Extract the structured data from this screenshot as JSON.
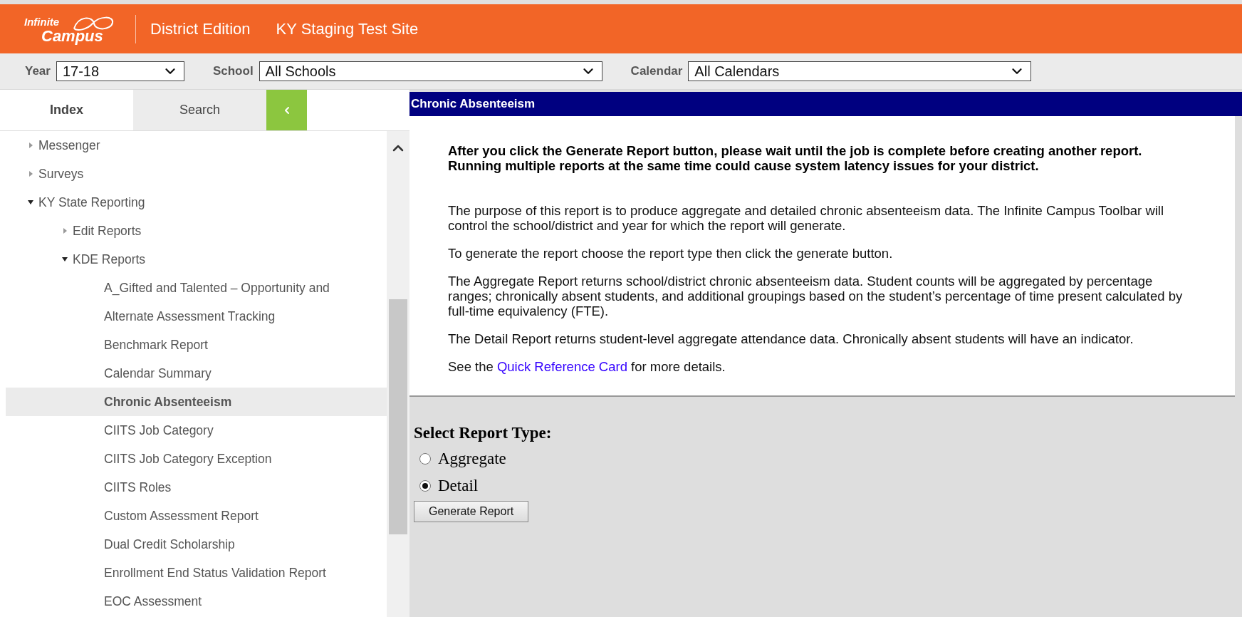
{
  "header": {
    "logo": {
      "top": "Infinite",
      "bottom": "Campus"
    },
    "edition": "District Edition",
    "site": "KY Staging Test Site"
  },
  "toolbar": [
    {
      "label": "Year",
      "value": "17-18",
      "kind": "short"
    },
    {
      "label": "School",
      "value": "All Schools",
      "kind": "wide"
    },
    {
      "label": "Calendar",
      "value": "All Calendars",
      "kind": "wide"
    }
  ],
  "sidebar": {
    "tabs": [
      {
        "label": "Index",
        "selected": true
      },
      {
        "label": "Search",
        "selected": false
      }
    ],
    "tree": [
      {
        "label": "Messenger",
        "expanded": false,
        "selected": false
      },
      {
        "label": "Surveys",
        "expanded": false,
        "selected": false
      },
      {
        "label": "KY State Reporting",
        "expanded": true,
        "selected": false,
        "children": [
          {
            "label": "Edit Reports",
            "expanded": false,
            "selected": false
          },
          {
            "label": "KDE Reports",
            "expanded": true,
            "selected": false,
            "children": [
              {
                "label": "A_Gifted and Talented – Opportunity and",
                "selected": false
              },
              {
                "label": "Alternate Assessment Tracking",
                "selected": false
              },
              {
                "label": "Benchmark Report",
                "selected": false
              },
              {
                "label": "Calendar Summary",
                "selected": false
              },
              {
                "label": "Chronic Absenteeism",
                "selected": true
              },
              {
                "label": "CIITS Job Category",
                "selected": false
              },
              {
                "label": "CIITS Job Category Exception",
                "selected": false
              },
              {
                "label": "CIITS Roles",
                "selected": false
              },
              {
                "label": "Custom Assessment Report",
                "selected": false
              },
              {
                "label": "Dual Credit Scholarship",
                "selected": false
              },
              {
                "label": "Enrollment End Status Validation Report",
                "selected": false
              },
              {
                "label": "EOC Assessment",
                "selected": false
              }
            ]
          }
        ]
      }
    ]
  },
  "content": {
    "title": "Chronic Absenteeism",
    "warning": "After you click the Generate Report button, please wait until the job is complete before creating another report. Running multiple reports at the same time could cause system latency issues for your district.",
    "paragraphs": [
      "The purpose of this report is to produce aggregate and detailed chronic absenteeism data. The Infinite Campus Toolbar will control the school/district and year for which the report will generate.",
      "To generate the report choose the report type then click the generate button.",
      "The Aggregate Report returns school/district chronic absenteeism data. Student counts will be aggregated by percentage ranges; chronically absent students, and additional groupings based on the student’s percentage of time present calculated by full-time equivalency (FTE).",
      "The Detail Report returns student-level aggregate attendance data. Chronically absent students will have an indicator."
    ],
    "reference": {
      "before": "See the ",
      "link": "Quick Reference Card",
      "after": " for more details."
    },
    "report_type": {
      "heading": "Select Report Type:",
      "options": [
        {
          "label": "Aggregate",
          "selected": false
        },
        {
          "label": "Detail",
          "selected": true
        }
      ]
    },
    "button": "Generate Report"
  }
}
